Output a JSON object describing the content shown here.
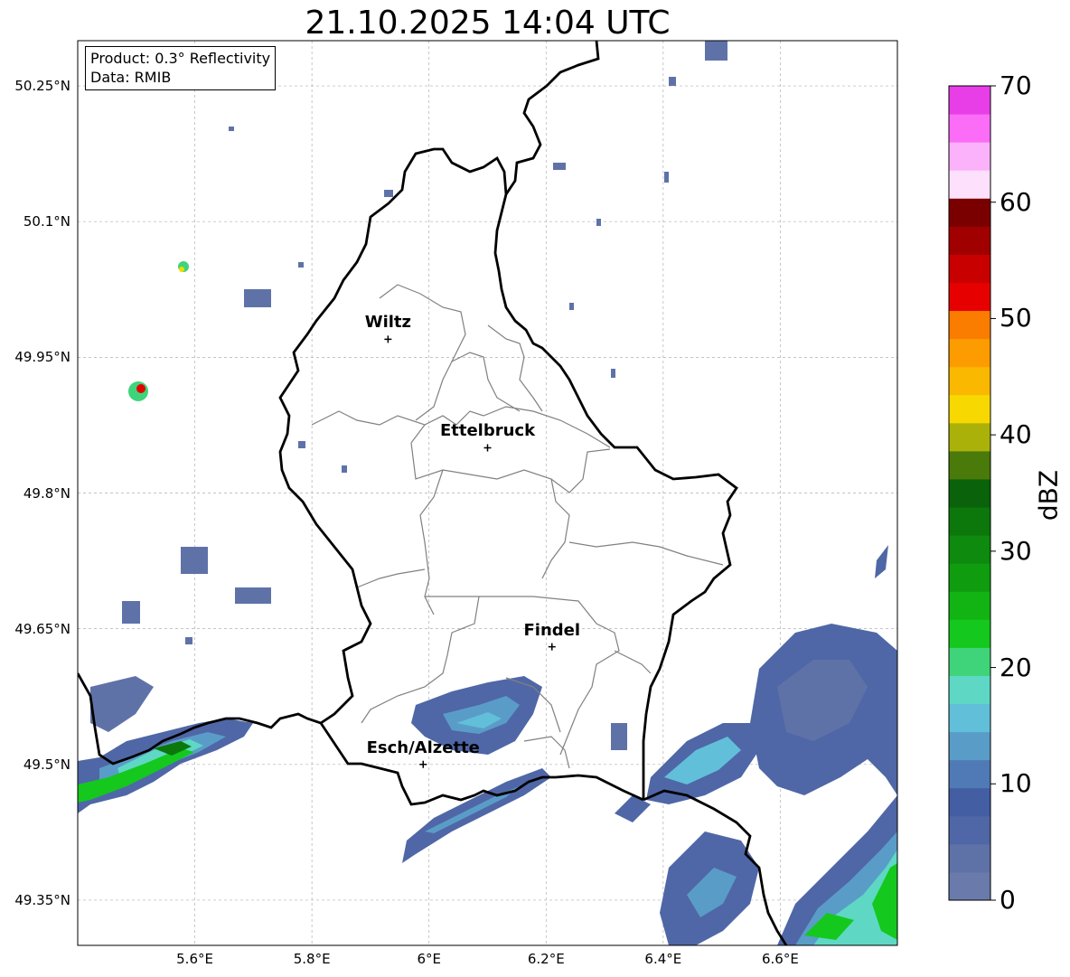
{
  "title": "21.10.2025 14:04 UTC",
  "info_box": {
    "product": "Product: 0.3° Reflectivity",
    "data_source": "Data: RMIB"
  },
  "map": {
    "lon_range": [
      5.4,
      6.8
    ],
    "lat_range": [
      49.3,
      50.3
    ],
    "gridlines": true,
    "lat_labels": [
      "50.25°N",
      "50.1°N",
      "49.95°N",
      "49.8°N",
      "49.65°N",
      "49.5°N",
      "49.35°N"
    ],
    "lon_labels": [
      "5.6°E",
      "5.8°E",
      "6°E",
      "6.2°E",
      "6.4°E",
      "6.6°E"
    ],
    "cities": [
      {
        "name": "Wiltz",
        "lon": 5.93,
        "lat": 49.97
      },
      {
        "name": "Ettelbruck",
        "lon": 6.1,
        "lat": 49.85
      },
      {
        "name": "Findel",
        "lon": 6.21,
        "lat": 49.63
      },
      {
        "name": "Esch/Alzette",
        "lon": 5.99,
        "lat": 49.5
      }
    ]
  },
  "colorbar": {
    "label": "dBZ",
    "ticks": [
      "0",
      "10",
      "20",
      "30",
      "40",
      "50",
      "60",
      "70"
    ],
    "colors": [
      "#6a7aaa",
      "#5f72a8",
      "#4f67a6",
      "#435ea3",
      "#4f7ab5",
      "#5a9cc8",
      "#62bfd9",
      "#5ed8c4",
      "#3fd47a",
      "#14c81e",
      "#12b414",
      "#0f9d0f",
      "#0e8a0e",
      "#0c780c",
      "#0a620a",
      "#4a7a0a",
      "#aab20a",
      "#f7d800",
      "#fbb800",
      "#fc9c00",
      "#fb7d00",
      "#e60000",
      "#c80000",
      "#a00000",
      "#7a0000",
      "#fde0fb",
      "#fcb2fb",
      "#fb6cf7",
      "#e83ee8"
    ]
  }
}
